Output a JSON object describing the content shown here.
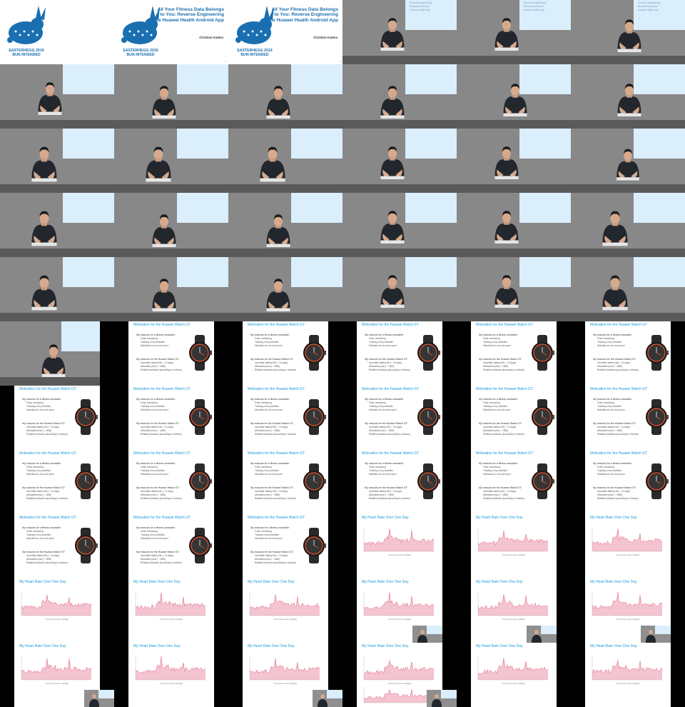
{
  "event": {
    "logo_lines": [
      "EASTERHEGG 2019",
      "BUN INTENDED"
    ],
    "talk_title": "All Your Fitness Data Belongs to You: Reverse Engineering the Huawei Health Android App",
    "author": "Christian Kudera",
    "slide_number": "1"
  },
  "watch_slide": {
    "title": "Motivation for the Huawei Watch GT",
    "section1": "My reasons for a fitness wearable:",
    "items1": [
      "Pulse monitoring",
      "Tracking of my activities",
      "Motivation to do more sport"
    ],
    "section2": "My reasons for the Huawei Watch GT:",
    "items2": [
      "Incredible battery life (~ 2x days)",
      "Affordable price (~ 150€)",
      "Reliable hardware (according to reviews)"
    ]
  },
  "hr_slide": {
    "title": "My Heart Rate Over One Day",
    "xlabel": "Time (hours since midnight)"
  },
  "projector_text": [
    "Reverse engineering",
    "Bluetooth protocol",
    "Huawei Health app"
  ],
  "colors": {
    "accent": "#1a9bd7",
    "logo": "#1a6fb0",
    "room": "#8f8f8f",
    "screen": "#dbeefb",
    "hr_line": "#e06080",
    "hr_fill": "#f4c4d0"
  },
  "layout_grid": {
    "columns": 6,
    "rows": 11
  },
  "tiles": [
    "title_logo",
    "title_full",
    "title_full",
    "speaker_a",
    "speaker_a",
    "speaker_b",
    "speaker_a",
    "speaker_c",
    "speaker_c",
    "speaker_c",
    "speaker_b",
    "speaker_b",
    "speaker_d",
    "speaker_d",
    "speaker_d",
    "speaker_a",
    "speaker_a",
    "speaker_e",
    "speaker_d",
    "speaker_c",
    "speaker_c",
    "speaker_a",
    "speaker_a",
    "speaker_d",
    "speaker_d",
    "speaker_c",
    "speaker_c",
    "speaker_a",
    "speaker_a",
    "speaker_d",
    "speaker_full",
    "watch_narrow",
    "watch_narrow",
    "watch_narrow",
    "watch_narrow",
    "watch_narrow",
    "watch",
    "watch",
    "watch",
    "watch",
    "watch",
    "watch",
    "watch",
    "watch",
    "watch",
    "watch",
    "watch",
    "watch",
    "watch",
    "watch",
    "watch",
    "hr",
    "hr",
    "hr",
    "hr",
    "hr",
    "hr",
    "hr_pip",
    "hr_pip",
    "hr_pip",
    "hr_pip2",
    "hr",
    "hr_pip2",
    "hr_pip_multi",
    "hr",
    "hr"
  ]
}
